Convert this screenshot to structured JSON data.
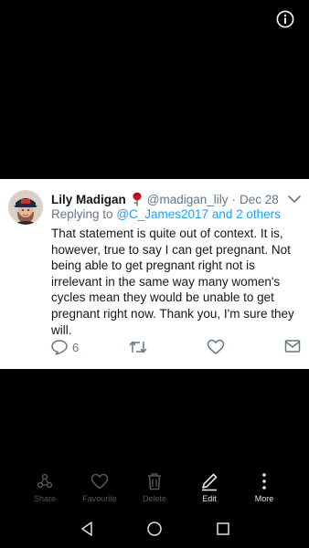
{
  "tweet": {
    "name": "Lily Madigan",
    "handle": "@madigan_lily",
    "separator": "·",
    "date": "Dec 28",
    "reply_prefix": "Replying to",
    "reply_targets": "@C_James2017 and 2 others",
    "text": "That statement is quite out of context. It is, however, true to say I can get pregnant. Not being able to get pregnant right not is irrelevant in the same way many women's cycles mean they would be unable to get pregnant right now. Thank you, I'm sure they will.",
    "reply_count": "6",
    "icons": {
      "reply": "reply-icon",
      "retweet": "retweet-icon",
      "like": "heart-icon",
      "dm": "envelope-icon",
      "menu": "chevron-down-icon",
      "badge": "rose-icon"
    }
  },
  "toolbar": {
    "share": "Share",
    "favourite": "Favourite",
    "delete": "Delete",
    "edit": "Edit",
    "more": "More"
  },
  "colors": {
    "background": "#000000",
    "card": "#ffffff",
    "text": "#14171a",
    "muted": "#657786",
    "link": "#1da1f2",
    "toolbar_disabled": "#555555",
    "toolbar_enabled": "#e6e6e6"
  }
}
